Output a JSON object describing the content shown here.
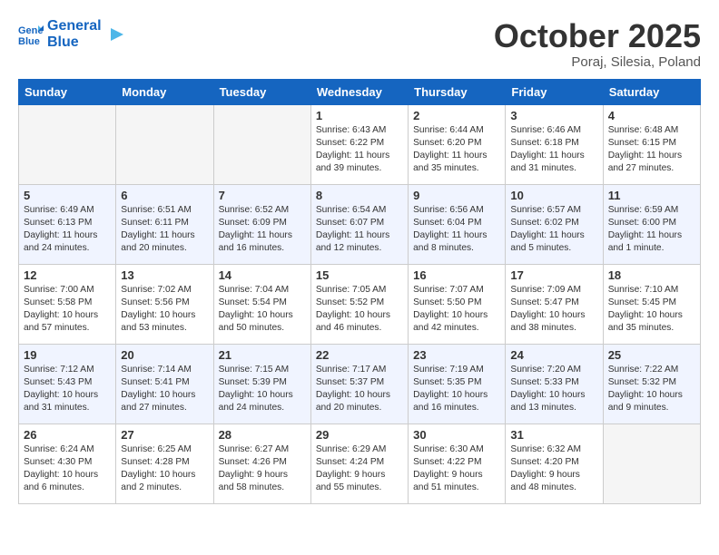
{
  "header": {
    "logo_line1": "General",
    "logo_line2": "Blue",
    "month": "October 2025",
    "location": "Poraj, Silesia, Poland"
  },
  "weekdays": [
    "Sunday",
    "Monday",
    "Tuesday",
    "Wednesday",
    "Thursday",
    "Friday",
    "Saturday"
  ],
  "weeks": [
    {
      "rowClass": "week-row-odd",
      "days": [
        {
          "date": "",
          "info": "",
          "empty": true
        },
        {
          "date": "",
          "info": "",
          "empty": true
        },
        {
          "date": "",
          "info": "",
          "empty": true
        },
        {
          "date": "1",
          "info": "Sunrise: 6:43 AM\nSunset: 6:22 PM\nDaylight: 11 hours\nand 39 minutes."
        },
        {
          "date": "2",
          "info": "Sunrise: 6:44 AM\nSunset: 6:20 PM\nDaylight: 11 hours\nand 35 minutes."
        },
        {
          "date": "3",
          "info": "Sunrise: 6:46 AM\nSunset: 6:18 PM\nDaylight: 11 hours\nand 31 minutes."
        },
        {
          "date": "4",
          "info": "Sunrise: 6:48 AM\nSunset: 6:15 PM\nDaylight: 11 hours\nand 27 minutes."
        }
      ]
    },
    {
      "rowClass": "week-row-even",
      "days": [
        {
          "date": "5",
          "info": "Sunrise: 6:49 AM\nSunset: 6:13 PM\nDaylight: 11 hours\nand 24 minutes."
        },
        {
          "date": "6",
          "info": "Sunrise: 6:51 AM\nSunset: 6:11 PM\nDaylight: 11 hours\nand 20 minutes."
        },
        {
          "date": "7",
          "info": "Sunrise: 6:52 AM\nSunset: 6:09 PM\nDaylight: 11 hours\nand 16 minutes."
        },
        {
          "date": "8",
          "info": "Sunrise: 6:54 AM\nSunset: 6:07 PM\nDaylight: 11 hours\nand 12 minutes."
        },
        {
          "date": "9",
          "info": "Sunrise: 6:56 AM\nSunset: 6:04 PM\nDaylight: 11 hours\nand 8 minutes."
        },
        {
          "date": "10",
          "info": "Sunrise: 6:57 AM\nSunset: 6:02 PM\nDaylight: 11 hours\nand 5 minutes."
        },
        {
          "date": "11",
          "info": "Sunrise: 6:59 AM\nSunset: 6:00 PM\nDaylight: 11 hours\nand 1 minute."
        }
      ]
    },
    {
      "rowClass": "week-row-odd",
      "days": [
        {
          "date": "12",
          "info": "Sunrise: 7:00 AM\nSunset: 5:58 PM\nDaylight: 10 hours\nand 57 minutes."
        },
        {
          "date": "13",
          "info": "Sunrise: 7:02 AM\nSunset: 5:56 PM\nDaylight: 10 hours\nand 53 minutes."
        },
        {
          "date": "14",
          "info": "Sunrise: 7:04 AM\nSunset: 5:54 PM\nDaylight: 10 hours\nand 50 minutes."
        },
        {
          "date": "15",
          "info": "Sunrise: 7:05 AM\nSunset: 5:52 PM\nDaylight: 10 hours\nand 46 minutes."
        },
        {
          "date": "16",
          "info": "Sunrise: 7:07 AM\nSunset: 5:50 PM\nDaylight: 10 hours\nand 42 minutes."
        },
        {
          "date": "17",
          "info": "Sunrise: 7:09 AM\nSunset: 5:47 PM\nDaylight: 10 hours\nand 38 minutes."
        },
        {
          "date": "18",
          "info": "Sunrise: 7:10 AM\nSunset: 5:45 PM\nDaylight: 10 hours\nand 35 minutes."
        }
      ]
    },
    {
      "rowClass": "week-row-even",
      "days": [
        {
          "date": "19",
          "info": "Sunrise: 7:12 AM\nSunset: 5:43 PM\nDaylight: 10 hours\nand 31 minutes."
        },
        {
          "date": "20",
          "info": "Sunrise: 7:14 AM\nSunset: 5:41 PM\nDaylight: 10 hours\nand 27 minutes."
        },
        {
          "date": "21",
          "info": "Sunrise: 7:15 AM\nSunset: 5:39 PM\nDaylight: 10 hours\nand 24 minutes."
        },
        {
          "date": "22",
          "info": "Sunrise: 7:17 AM\nSunset: 5:37 PM\nDaylight: 10 hours\nand 20 minutes."
        },
        {
          "date": "23",
          "info": "Sunrise: 7:19 AM\nSunset: 5:35 PM\nDaylight: 10 hours\nand 16 minutes."
        },
        {
          "date": "24",
          "info": "Sunrise: 7:20 AM\nSunset: 5:33 PM\nDaylight: 10 hours\nand 13 minutes."
        },
        {
          "date": "25",
          "info": "Sunrise: 7:22 AM\nSunset: 5:32 PM\nDaylight: 10 hours\nand 9 minutes."
        }
      ]
    },
    {
      "rowClass": "week-row-odd",
      "days": [
        {
          "date": "26",
          "info": "Sunrise: 6:24 AM\nSunset: 4:30 PM\nDaylight: 10 hours\nand 6 minutes."
        },
        {
          "date": "27",
          "info": "Sunrise: 6:25 AM\nSunset: 4:28 PM\nDaylight: 10 hours\nand 2 minutes."
        },
        {
          "date": "28",
          "info": "Sunrise: 6:27 AM\nSunset: 4:26 PM\nDaylight: 9 hours\nand 58 minutes."
        },
        {
          "date": "29",
          "info": "Sunrise: 6:29 AM\nSunset: 4:24 PM\nDaylight: 9 hours\nand 55 minutes."
        },
        {
          "date": "30",
          "info": "Sunrise: 6:30 AM\nSunset: 4:22 PM\nDaylight: 9 hours\nand 51 minutes."
        },
        {
          "date": "31",
          "info": "Sunrise: 6:32 AM\nSunset: 4:20 PM\nDaylight: 9 hours\nand 48 minutes."
        },
        {
          "date": "",
          "info": "",
          "empty": true,
          "last": true
        }
      ]
    }
  ]
}
